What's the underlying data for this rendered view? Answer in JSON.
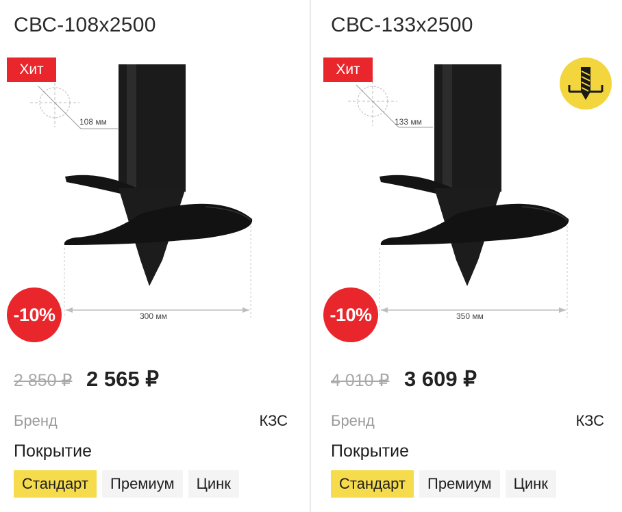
{
  "products": [
    {
      "title": "СВС-108х2500",
      "badge": "Хит",
      "discount": "-10%",
      "diameter_label": "108 мм",
      "width_label": "300 мм",
      "old_price": "2 850 ₽",
      "price": "2 565 ₽",
      "brand_label": "Бренд",
      "brand_value": "КЗС",
      "coating_label": "Покрытие",
      "coating_options": [
        "Стандарт",
        "Премиум",
        "Цинк"
      ],
      "coating_selected": "Стандарт",
      "drill_badge": false
    },
    {
      "title": "СВС-133х2500",
      "badge": "Хит",
      "discount": "-10%",
      "diameter_label": "133 мм",
      "width_label": "350 мм",
      "old_price": "4 010 ₽",
      "price": "3 609 ₽",
      "brand_label": "Бренд",
      "brand_value": "КЗС",
      "coating_label": "Покрытие",
      "coating_options": [
        "Стандарт",
        "Премиум",
        "Цинк"
      ],
      "coating_selected": "Стандарт",
      "drill_badge": true,
      "drill_badge_icon": "drill-icon"
    }
  ],
  "colors": {
    "accent_red": "#e8262b",
    "accent_yellow": "#f6dc4c",
    "text": "#1f1f1f",
    "muted": "#9a9a9a"
  }
}
